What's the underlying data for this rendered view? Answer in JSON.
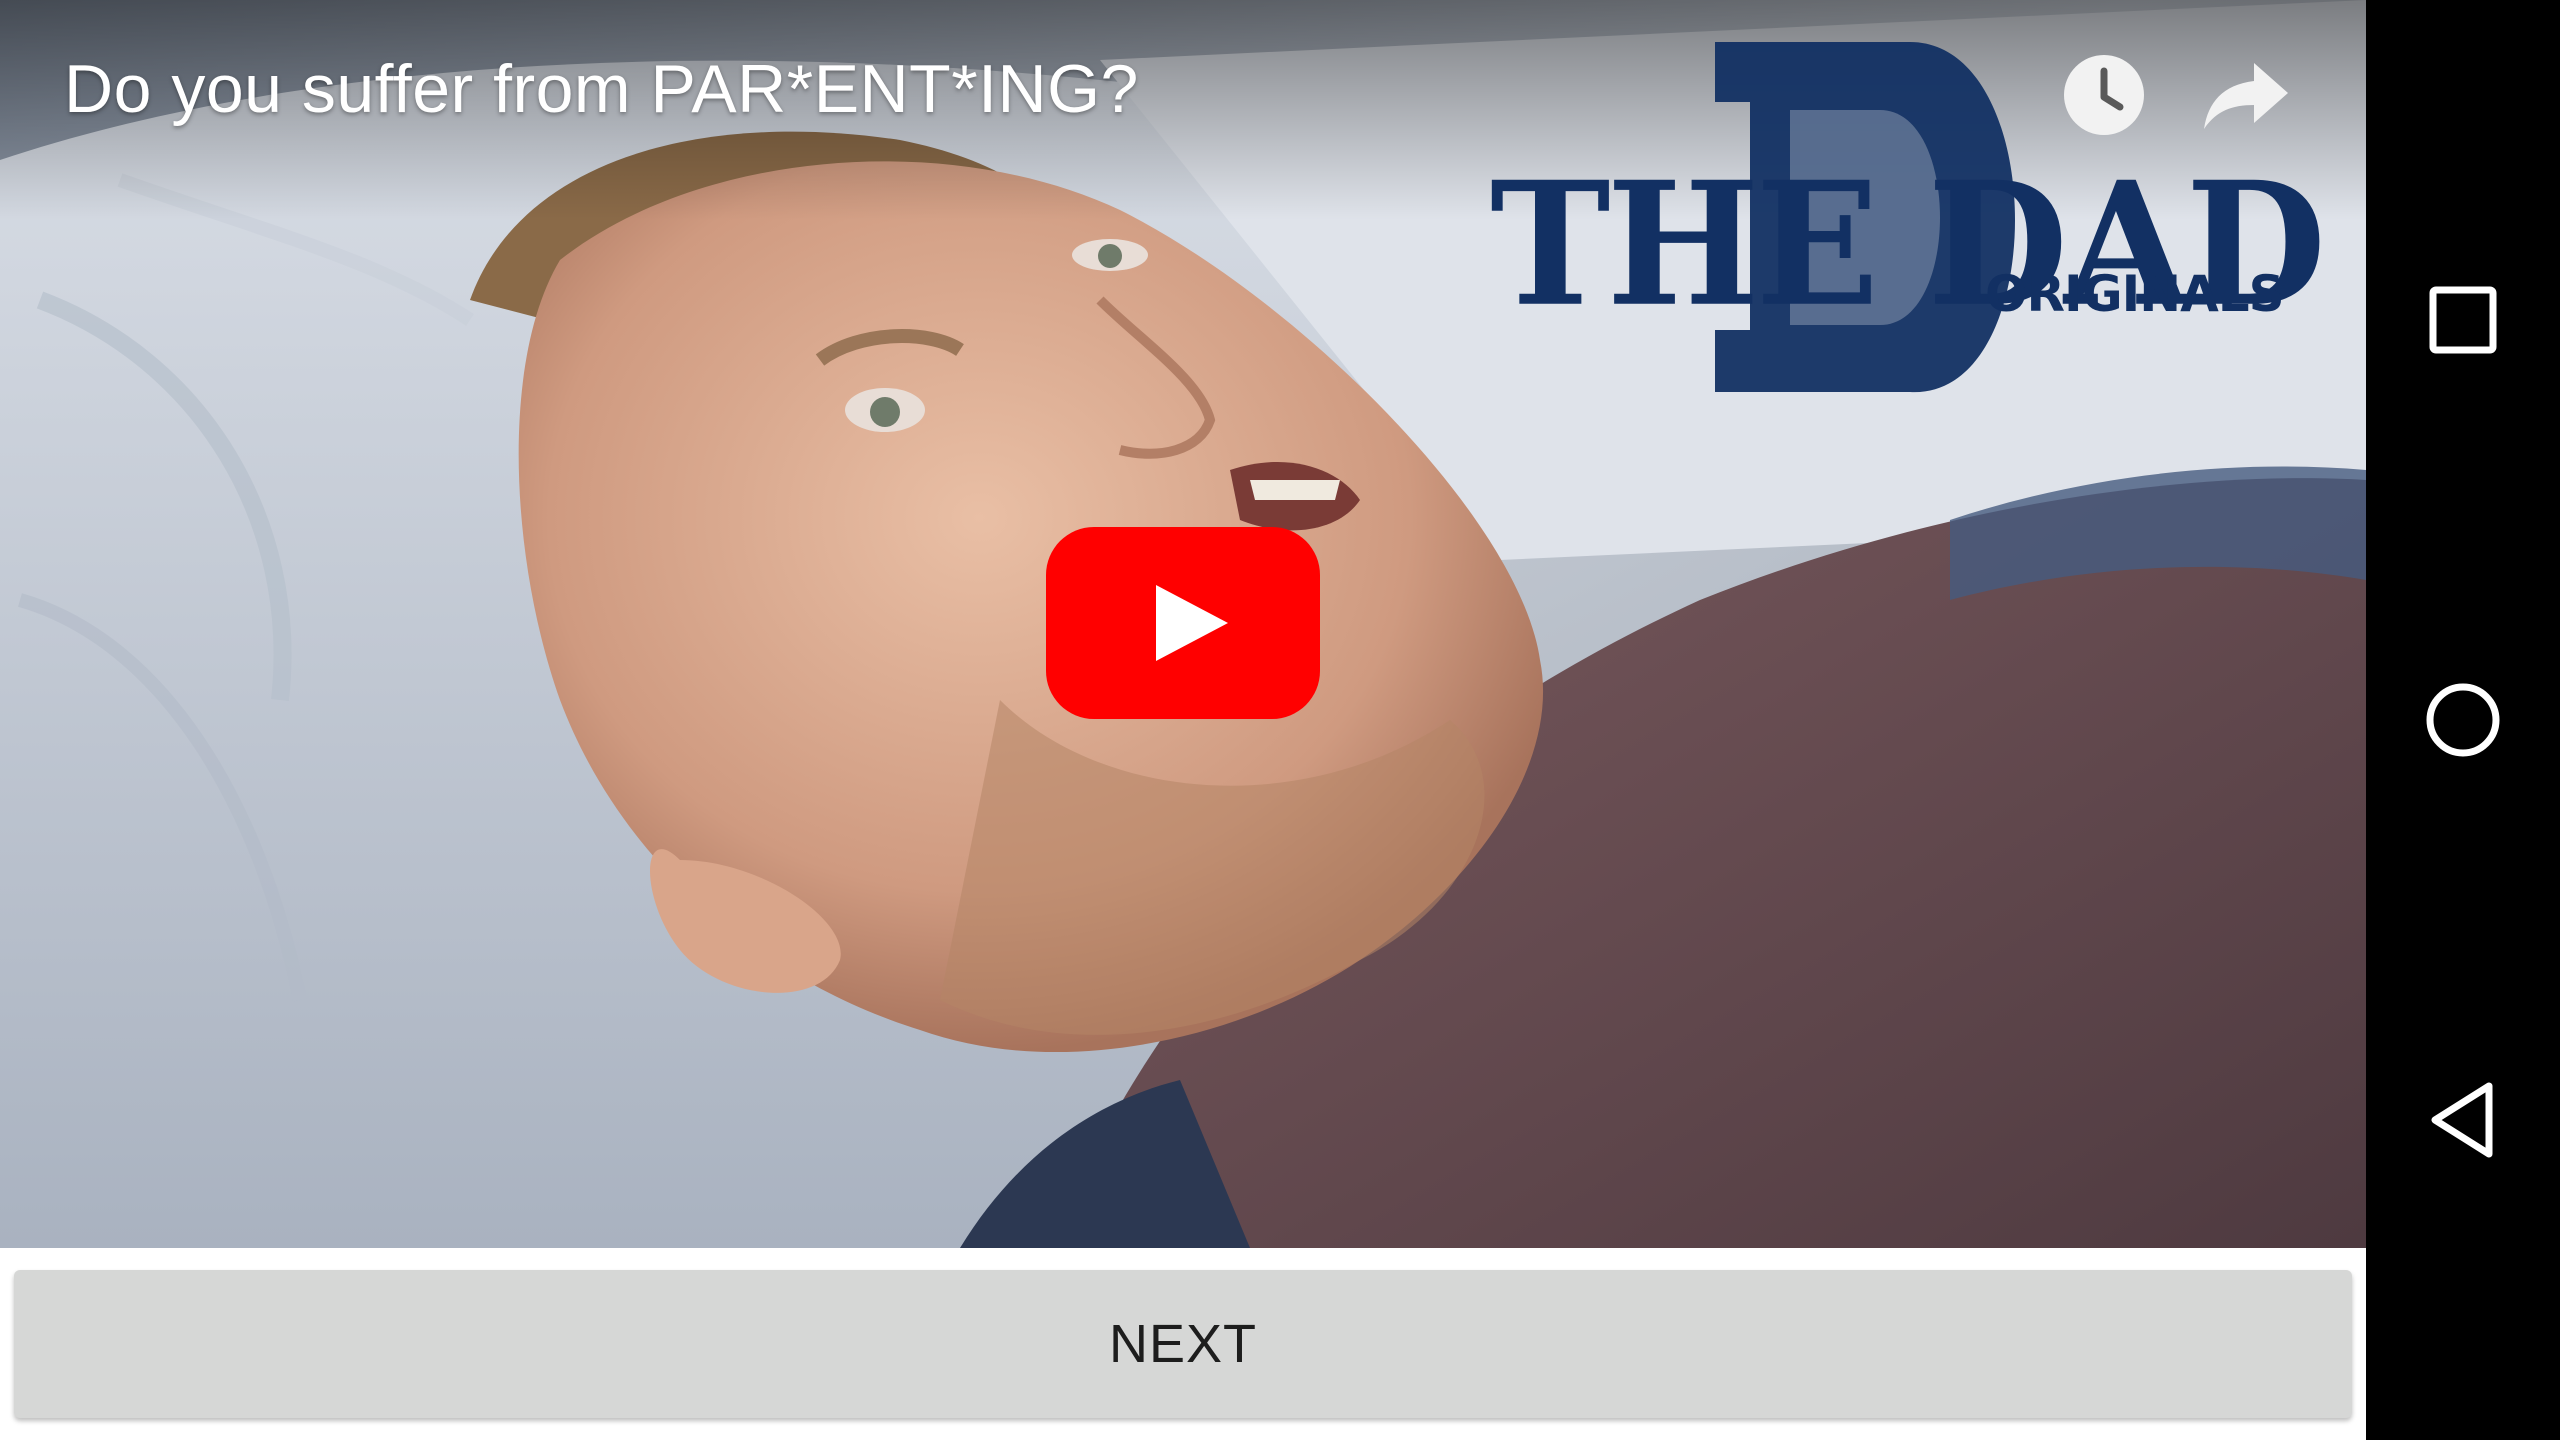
{
  "video": {
    "title": "Do you suffer from PAR*ENT*ING?",
    "channel_logo": {
      "main_text": "THE DAD",
      "sub_text": "ORIGINALS",
      "color": "#123063"
    },
    "actions": {
      "watch_later_icon": "clock-icon",
      "share_icon": "share-arrow-icon"
    },
    "play_button_color": "#ff0000"
  },
  "next_button": {
    "label": "NEXT"
  },
  "nav_bar": {
    "recents_icon": "square-icon",
    "home_icon": "circle-icon",
    "back_icon": "triangle-back-icon"
  }
}
